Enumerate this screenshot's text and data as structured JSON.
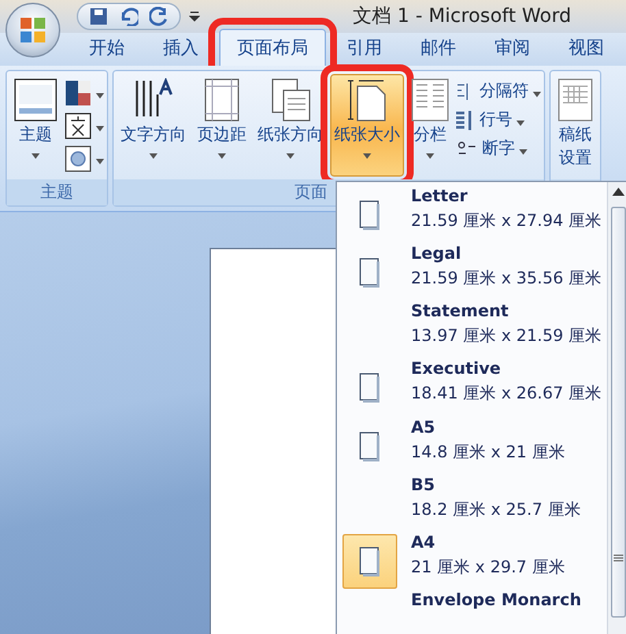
{
  "window": {
    "title": "文档 1 - Microsoft Word"
  },
  "tabs": [
    {
      "label": "开始",
      "selected": false,
      "highlighted": false
    },
    {
      "label": "插入",
      "selected": false,
      "highlighted": false
    },
    {
      "label": "页面布局",
      "selected": true,
      "highlighted": true
    },
    {
      "label": "引用",
      "selected": false,
      "highlighted": false
    },
    {
      "label": "邮件",
      "selected": false,
      "highlighted": false
    },
    {
      "label": "审阅",
      "selected": false,
      "highlighted": false
    },
    {
      "label": "视图",
      "selected": false,
      "highlighted": false
    }
  ],
  "ribbon": {
    "groups": [
      {
        "label": "主题",
        "large": [
          {
            "label": "主题",
            "kind": "theme",
            "pressed": false
          }
        ],
        "small": [
          {
            "kind": "colors"
          },
          {
            "kind": "fonts"
          },
          {
            "kind": "effects"
          }
        ]
      },
      {
        "label": "页面",
        "large": [
          {
            "label": "文字方向",
            "kind": "textdir",
            "pressed": false,
            "highlighted": false
          },
          {
            "label": "页边距",
            "kind": "margins",
            "pressed": false,
            "highlighted": false
          },
          {
            "label": "纸张方向",
            "kind": "orient",
            "pressed": false,
            "highlighted": false
          },
          {
            "label": "纸张大小",
            "kind": "size",
            "pressed": true,
            "highlighted": true
          },
          {
            "label": "分栏",
            "kind": "columns",
            "pressed": false,
            "highlighted": false
          }
        ],
        "small_text": [
          {
            "label": "分隔符",
            "kind": "breaks"
          },
          {
            "label": "行号",
            "kind": "linenum"
          },
          {
            "label": "断字",
            "kind": "hyphen"
          }
        ]
      },
      {
        "large": [
          {
            "label": "稿纸设置",
            "kind": "draft",
            "pressed": false
          }
        ]
      }
    ]
  },
  "paper_menu": {
    "items": [
      {
        "name": "Letter",
        "size": "21.59 厘米 x 27.94 厘米",
        "has_icon": true,
        "selected": false
      },
      {
        "name": "Legal",
        "size": "21.59 厘米 x 35.56 厘米",
        "has_icon": true,
        "selected": false
      },
      {
        "name": "Statement",
        "size": "13.97 厘米 x 21.59 厘米",
        "has_icon": false,
        "selected": false
      },
      {
        "name": "Executive",
        "size": "18.41 厘米 x 26.67 厘米",
        "has_icon": true,
        "selected": false
      },
      {
        "name": "A5",
        "size": "14.8 厘米 x 21 厘米",
        "has_icon": true,
        "selected": false
      },
      {
        "name": "B5",
        "size": "18.2 厘米 x 25.7 厘米",
        "has_icon": false,
        "selected": false
      },
      {
        "name": "A4",
        "size": "21 厘米 x 29.7 厘米",
        "has_icon": true,
        "selected": true
      },
      {
        "name": "Envelope Monarch",
        "has_icon": false,
        "selected": false
      }
    ]
  }
}
